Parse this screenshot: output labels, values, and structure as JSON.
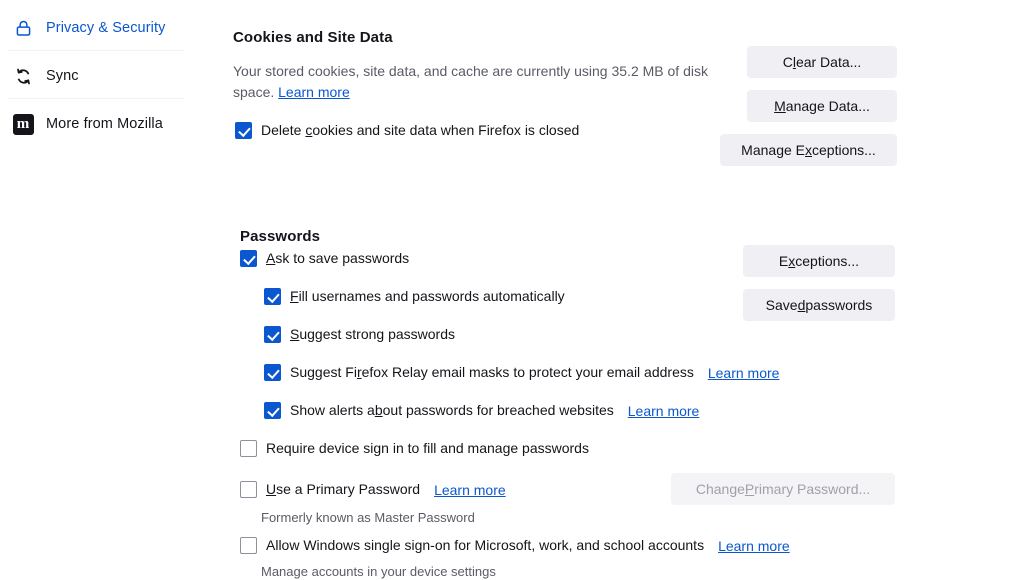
{
  "sidebar": {
    "items": [
      {
        "label": "Privacy & Security",
        "icon": "lock-icon",
        "selected": true
      },
      {
        "label": "Sync",
        "icon": "sync-icon",
        "selected": false
      },
      {
        "label": "More from Mozilla",
        "icon": "mozilla-logo-icon",
        "selected": false
      }
    ],
    "mozilla_badge_letter": "m"
  },
  "colors": {
    "accent_blue": "#0a57d0",
    "link_blue": "#0a57d0",
    "button_bg": "#f0f0f4",
    "text": "#15141a",
    "muted_text": "#5b5b66"
  },
  "cookies": {
    "title": "Cookies and Site Data",
    "description_part1": "Your stored cookies, site data, and cache are currently using 35.2 MB of disk space.",
    "description_learn_more": "Learn more",
    "storage_used": "35.2 MB",
    "buttons": [
      {
        "label": "Clear Data...",
        "accesskey": "l",
        "disabled": false
      },
      {
        "label": "Manage Data...",
        "accesskey": "M",
        "disabled": false
      },
      {
        "label": "Manage Exceptions...",
        "accesskey": "x",
        "disabled": false
      }
    ],
    "delete_on_close": {
      "label_before": "Delete ",
      "accesskey": "c",
      "label_after": "ookies and site data when Firefox is closed",
      "checked": true
    }
  },
  "passwords": {
    "title": "Passwords",
    "buttons": [
      {
        "label": "Exceptions...",
        "accesskey": "x",
        "disabled": false
      },
      {
        "label": "Saved passwords",
        "accesskey": "d",
        "disabled": false
      },
      {
        "label": "Change Primary Password...",
        "accesskey": "P",
        "disabled": true
      }
    ],
    "options": [
      {
        "name": "ask-to-save-passwords",
        "before": "",
        "accesskey": "A",
        "after": "sk to save passwords",
        "checked": true,
        "indent": 0,
        "learn_more": null,
        "sublabel": null
      },
      {
        "name": "fill-usernames-automatically",
        "before": "",
        "accesskey": "F",
        "after": "ill usernames and passwords automatically",
        "checked": true,
        "indent": 1,
        "learn_more": null,
        "sublabel": null
      },
      {
        "name": "suggest-strong-passwords",
        "before": "",
        "accesskey": "S",
        "after": "uggest strong passwords",
        "checked": true,
        "indent": 1,
        "learn_more": null,
        "sublabel": null
      },
      {
        "name": "suggest-firefox-relay",
        "before": "Suggest Fi",
        "accesskey": "r",
        "after": "efox Relay email masks to protect your email address",
        "checked": true,
        "indent": 1,
        "learn_more": "Learn more",
        "sublabel": null
      },
      {
        "name": "show-breach-alerts",
        "before": "Show alerts a",
        "accesskey": "b",
        "after": "out passwords for breached websites",
        "checked": true,
        "indent": 1,
        "learn_more": "Learn more",
        "sublabel": null
      },
      {
        "name": "require-device-sign-in",
        "before": "Require device sign in to fill and manage passwords",
        "accesskey": "",
        "after": "",
        "checked": false,
        "indent": 0,
        "learn_more": null,
        "sublabel": null
      },
      {
        "name": "use-primary-password",
        "before": "",
        "accesskey": "U",
        "after": "se a Primary Password",
        "checked": false,
        "indent": 0,
        "learn_more": "Learn more",
        "sublabel": "Formerly known as Master Password"
      },
      {
        "name": "allow-windows-sso",
        "before": "Allow Windows single sign-on for Microsoft, work, and school accounts",
        "accesskey": "",
        "after": "",
        "checked": false,
        "indent": 0,
        "learn_more": "Learn more",
        "sublabel": "Manage accounts in your device settings"
      }
    ]
  }
}
